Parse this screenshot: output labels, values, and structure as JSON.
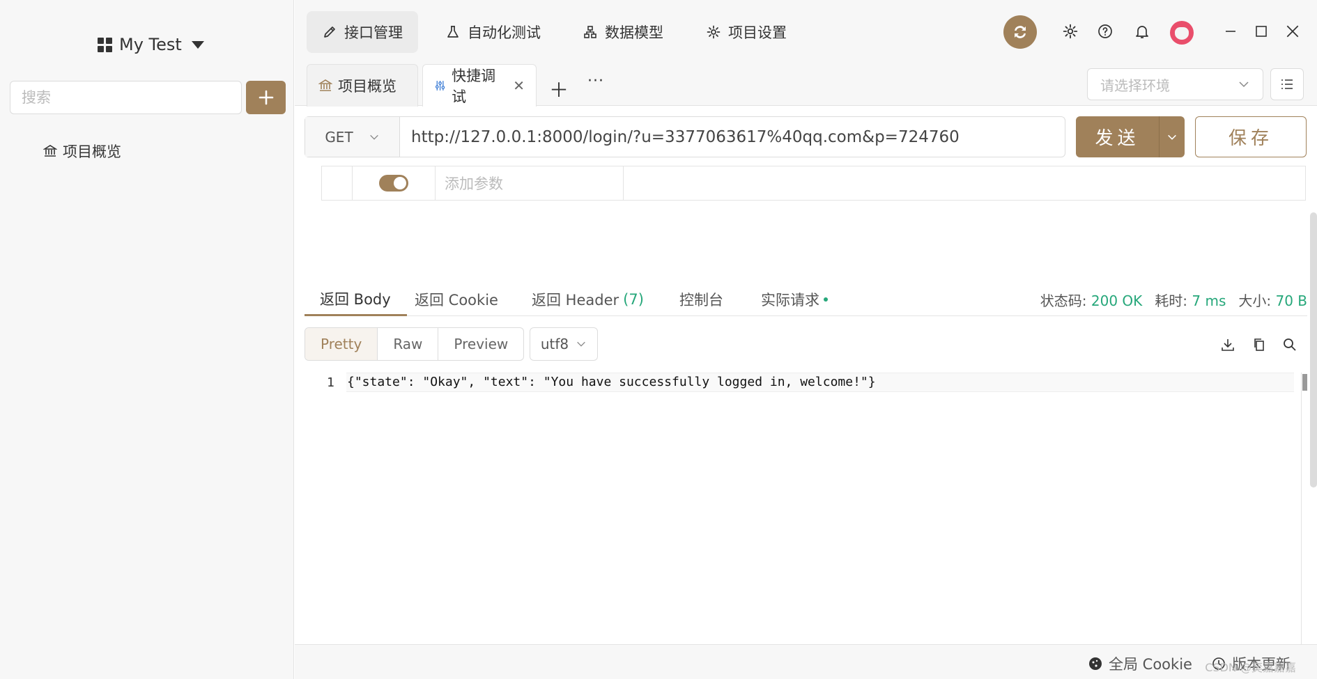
{
  "sidebar": {
    "project_name": "My Test",
    "search_placeholder": "搜索",
    "items": [
      {
        "label": "项目概览",
        "icon": "bank-icon"
      }
    ]
  },
  "top_nav": {
    "tabs": [
      {
        "label": "接口管理",
        "icon": "pen-icon",
        "active": true
      },
      {
        "label": "自动化测试",
        "icon": "flask-icon",
        "active": false
      },
      {
        "label": "数据模型",
        "icon": "hierarchy-icon",
        "active": false
      },
      {
        "label": "项目设置",
        "icon": "gear-icon",
        "active": false
      }
    ]
  },
  "doc_tabs": [
    {
      "label": "项目概览",
      "icon": "bank-icon",
      "active": false
    },
    {
      "label": "快捷调试",
      "icon": "sliders-icon",
      "active": true
    }
  ],
  "environment": {
    "placeholder": "请选择环境"
  },
  "request": {
    "method": "GET",
    "url": "http://127.0.0.1:8000/login/?u=3377063617%40qq.com&p=724760",
    "send_label": "发送",
    "save_label": "保存",
    "param_placeholder": "添加参数"
  },
  "response": {
    "tabs": {
      "body": "返回 Body",
      "cookie": "返回 Cookie",
      "header": "返回 Header",
      "header_count": "(7)",
      "console": "控制台",
      "actual": "实际请求"
    },
    "stats": {
      "status_label": "状态码:",
      "status_value": "200 OK",
      "time_label": "耗时:",
      "time_value": "7 ms",
      "size_label": "大小:",
      "size_value": "70 B"
    },
    "formats": [
      "Pretty",
      "Raw",
      "Preview"
    ],
    "encoding": "utf8",
    "line_number": "1",
    "body_text": "{\"state\": \"Okay\", \"text\": \"You have successfully logged in, welcome!\"}"
  },
  "footer": {
    "cookie_label": "全局 Cookie",
    "update_label": "版本更新"
  },
  "watermark": "CSDN @奕嘉嘉嘉",
  "colors": {
    "accent": "#a0815a",
    "success": "#26a77a",
    "avatar": "#e94e6b"
  }
}
